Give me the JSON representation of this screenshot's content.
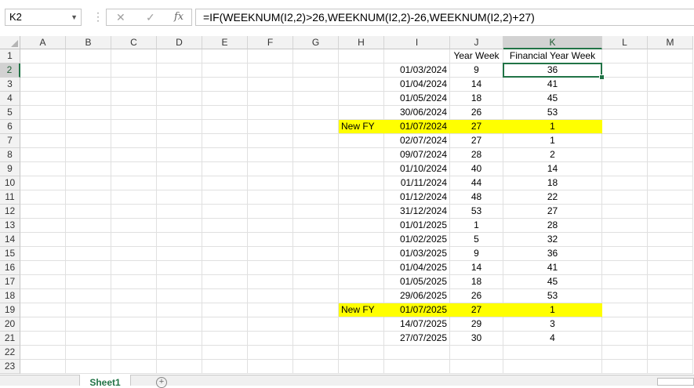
{
  "name_box": "K2",
  "formula": "=IF(WEEKNUM(I2,2)>26,WEEKNUM(I2,2)-26,WEEKNUM(I2,2)+27)",
  "fx_label": "fx",
  "columns": [
    "A",
    "B",
    "C",
    "D",
    "E",
    "F",
    "G",
    "H",
    "I",
    "J",
    "K",
    "L",
    "M"
  ],
  "rows": [
    "1",
    "2",
    "3",
    "4",
    "5",
    "6",
    "7",
    "8",
    "9",
    "10",
    "11",
    "12",
    "13",
    "14",
    "15",
    "16",
    "17",
    "18",
    "19",
    "20",
    "21",
    "22",
    "23"
  ],
  "selected_cell": "K2",
  "highlight_color": "#ffff00",
  "accent_color": "#217346",
  "headers": {
    "J": "Year Week",
    "K": "Financial Year Week"
  },
  "table": [
    {
      "h": "",
      "date": "01/03/2024",
      "yw": "9",
      "fyw": "36"
    },
    {
      "h": "",
      "date": "01/04/2024",
      "yw": "14",
      "fyw": "41"
    },
    {
      "h": "",
      "date": "01/05/2024",
      "yw": "18",
      "fyw": "45"
    },
    {
      "h": "",
      "date": "30/06/2024",
      "yw": "26",
      "fyw": "53"
    },
    {
      "h": "New FY",
      "date": "01/07/2024",
      "yw": "27",
      "fyw": "1",
      "highlight": true
    },
    {
      "h": "",
      "date": "02/07/2024",
      "yw": "27",
      "fyw": "1"
    },
    {
      "h": "",
      "date": "09/07/2024",
      "yw": "28",
      "fyw": "2"
    },
    {
      "h": "",
      "date": "01/10/2024",
      "yw": "40",
      "fyw": "14"
    },
    {
      "h": "",
      "date": "01/11/2024",
      "yw": "44",
      "fyw": "18"
    },
    {
      "h": "",
      "date": "01/12/2024",
      "yw": "48",
      "fyw": "22"
    },
    {
      "h": "",
      "date": "31/12/2024",
      "yw": "53",
      "fyw": "27"
    },
    {
      "h": "",
      "date": "01/01/2025",
      "yw": "1",
      "fyw": "28"
    },
    {
      "h": "",
      "date": "01/02/2025",
      "yw": "5",
      "fyw": "32"
    },
    {
      "h": "",
      "date": "01/03/2025",
      "yw": "9",
      "fyw": "36"
    },
    {
      "h": "",
      "date": "01/04/2025",
      "yw": "14",
      "fyw": "41"
    },
    {
      "h": "",
      "date": "01/05/2025",
      "yw": "18",
      "fyw": "45"
    },
    {
      "h": "",
      "date": "29/06/2025",
      "yw": "26",
      "fyw": "53"
    },
    {
      "h": "New FY",
      "date": "01/07/2025",
      "yw": "27",
      "fyw": "1",
      "highlight": true
    },
    {
      "h": "",
      "date": "14/07/2025",
      "yw": "29",
      "fyw": "3"
    },
    {
      "h": "",
      "date": "27/07/2025",
      "yw": "30",
      "fyw": "4"
    }
  ],
  "sheet_tab": "Sheet1"
}
